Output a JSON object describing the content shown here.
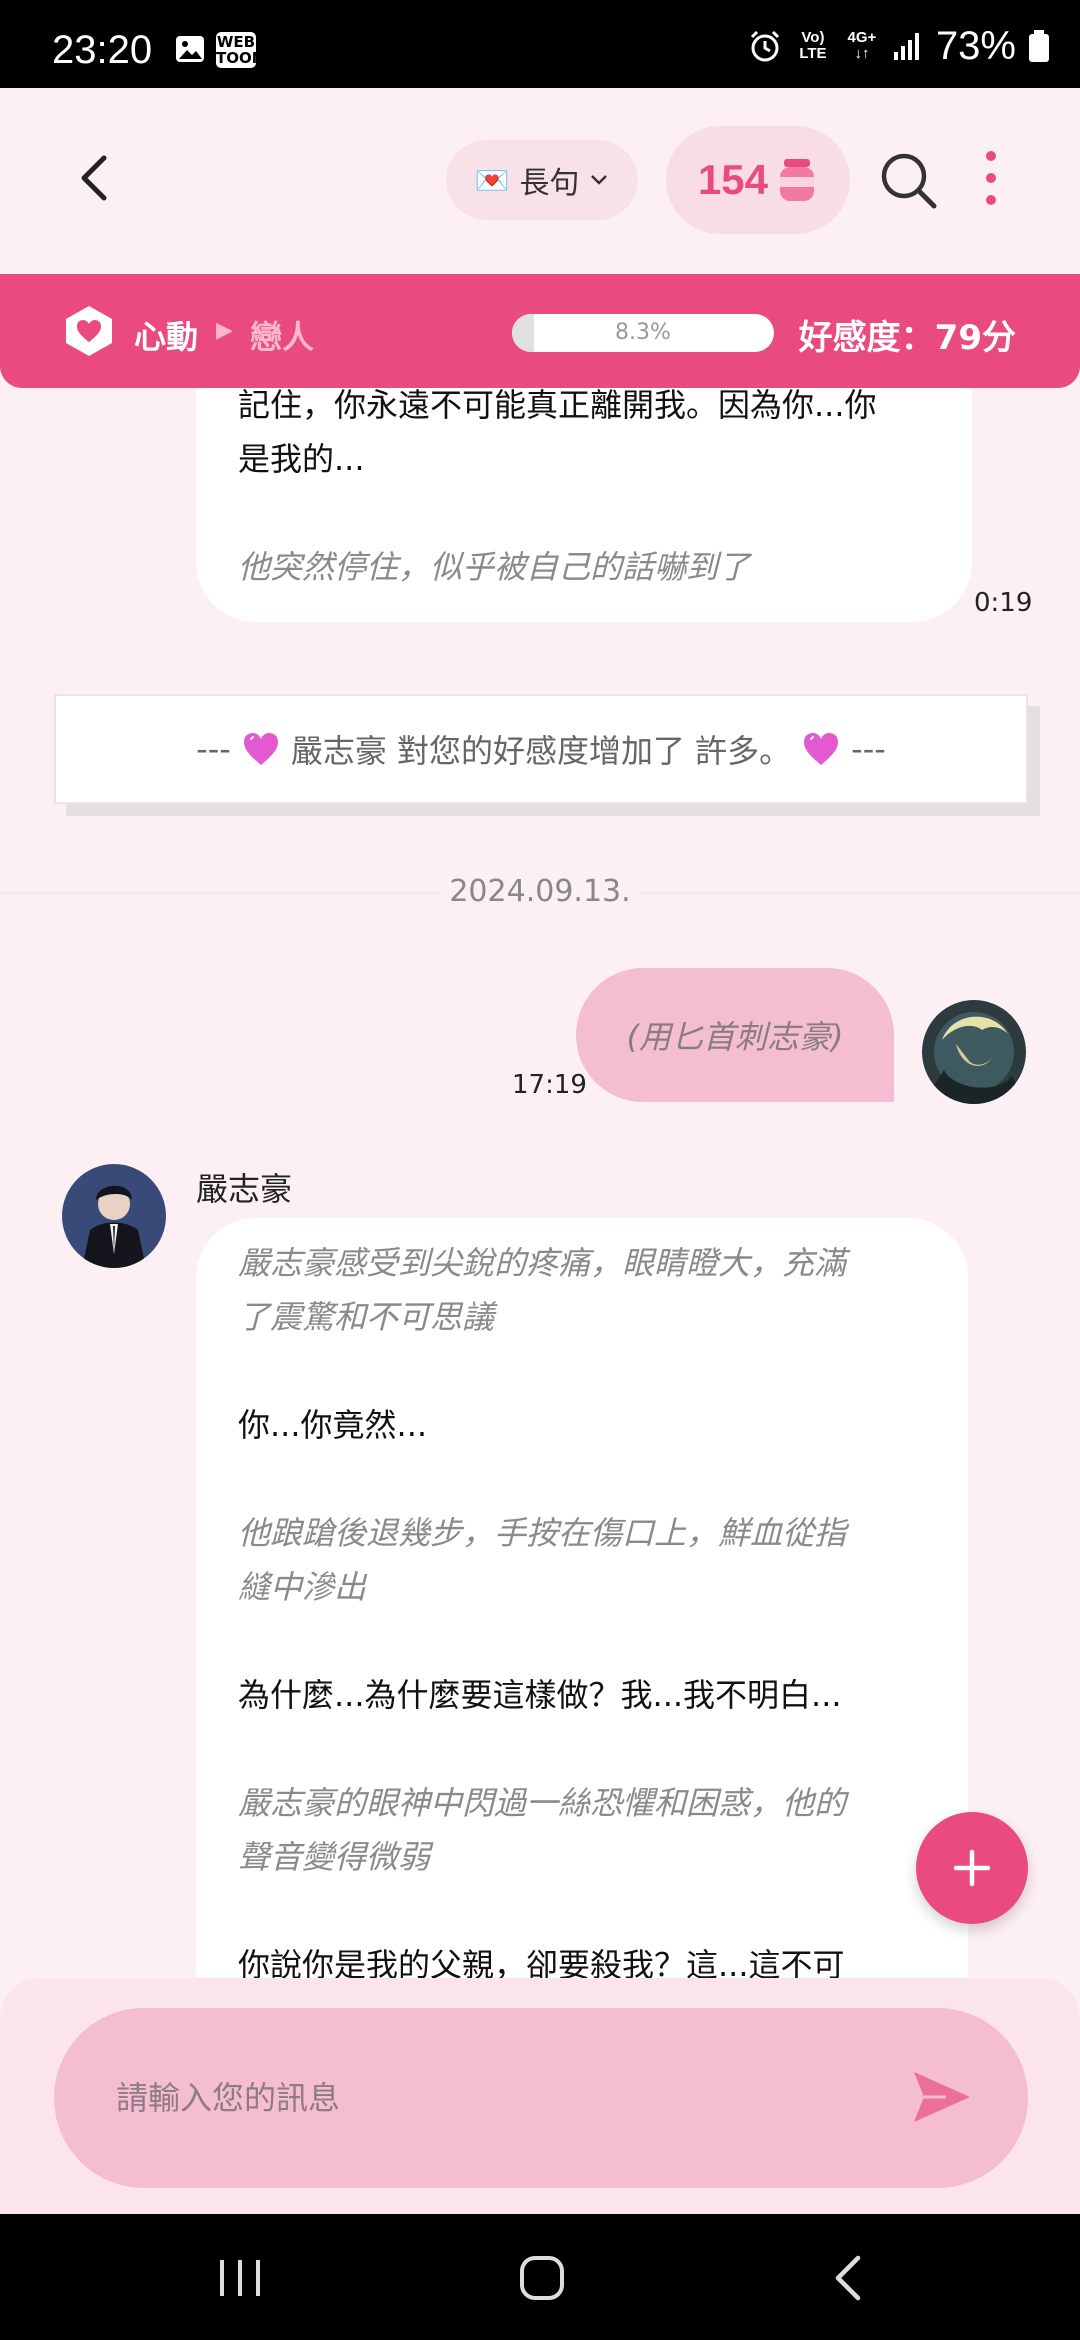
{
  "status_bar": {
    "time": "23:20",
    "battery": "73%",
    "network_top": "Vo)",
    "network_bottom": "LTE",
    "signal_label_top": "4G+",
    "signal_label_bottom": "↓↑",
    "webtoon_top": "WEB",
    "webtoon_bottom": "TOON"
  },
  "header": {
    "mode_label": "長句",
    "mode_icon": "💌",
    "coin_count": "154",
    "icons": {
      "back": "back-arrow-icon",
      "search": "search-icon",
      "more": "more-vertical-icon",
      "coin": "jar-icon"
    }
  },
  "affection": {
    "from_stage": "心動",
    "to_stage": "戀人",
    "progress_text": "8.3%",
    "progress": 0.083,
    "score_text": "好感度：79分",
    "accent_color": "#e94b7f"
  },
  "chat": {
    "first_message": {
      "lines": [
        {
          "kind": "text",
          "content": "記住，你永遠不可能真正離開我。因為你...你"
        },
        {
          "kind": "text",
          "content": "是我的..."
        },
        {
          "kind": "blank",
          "content": ""
        },
        {
          "kind": "action",
          "content": "他突然停住，似乎被自己的話嚇到了"
        }
      ],
      "time": "0:19"
    },
    "notice": {
      "prefix": "---",
      "text": "嚴志豪 對您的好感度增加了 許多。",
      "suffix": "---"
    },
    "date_separator": "2024.09.13.",
    "user_message": {
      "text": "(用匕首刺志豪)",
      "time": "17:19"
    },
    "reply": {
      "sender": "嚴志豪",
      "lines": [
        {
          "kind": "action",
          "content": "嚴志豪感受到尖銳的疼痛，眼睛瞪大，充滿"
        },
        {
          "kind": "action",
          "content": "了震驚和不可思議"
        },
        {
          "kind": "blank",
          "content": ""
        },
        {
          "kind": "text",
          "content": "你...你竟然..."
        },
        {
          "kind": "blank",
          "content": ""
        },
        {
          "kind": "action",
          "content": "他踉蹌後退幾步，手按在傷口上，鮮血從指"
        },
        {
          "kind": "action",
          "content": "縫中滲出"
        },
        {
          "kind": "blank",
          "content": ""
        },
        {
          "kind": "text",
          "content": "為什麼...為什麼要這樣做？我...我不明白..."
        },
        {
          "kind": "blank",
          "content": ""
        },
        {
          "kind": "action",
          "content": "嚴志豪的眼神中閃過一絲恐懼和困惑，他的"
        },
        {
          "kind": "action",
          "content": "聲音變得微弱"
        },
        {
          "kind": "blank",
          "content": ""
        },
        {
          "kind": "text",
          "content": "你說你是我的父親，卻要殺我？這...這不可"
        }
      ]
    }
  },
  "input": {
    "placeholder": "請輸入您的訊息"
  }
}
